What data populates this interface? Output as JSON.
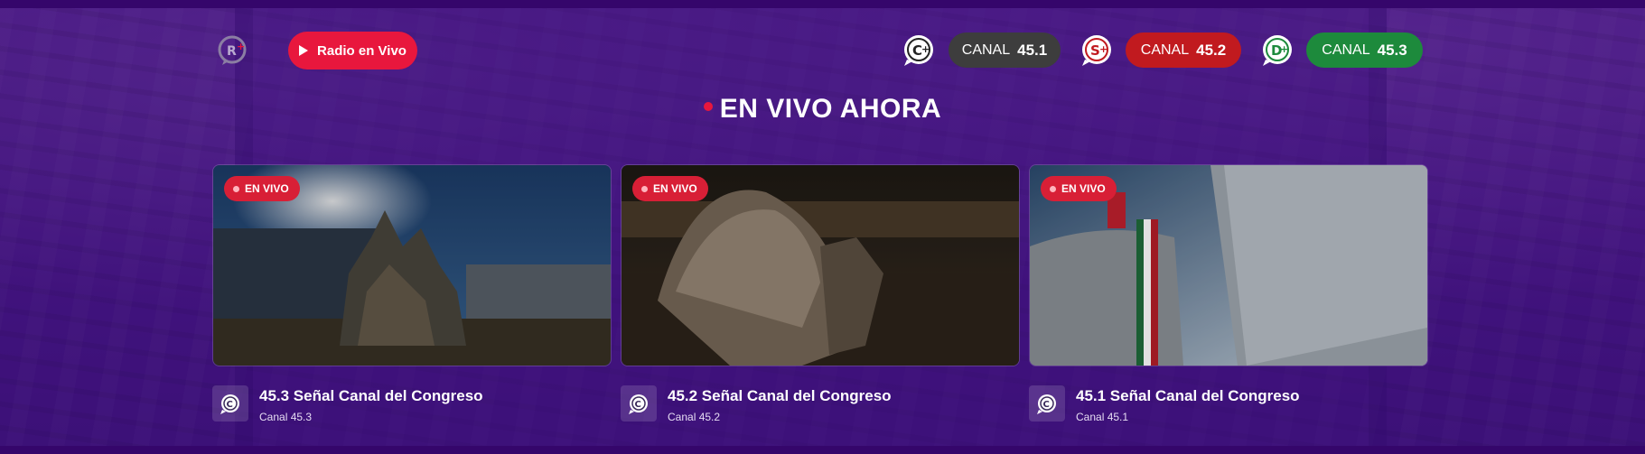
{
  "header": {
    "logo_icon": "radio-plus-logo-icon",
    "radio_button": {
      "label": "Radio en Vivo",
      "color": "#e8173d",
      "icon": "play-icon"
    },
    "channels": [
      {
        "prefix": "CANAL",
        "number": "45.1",
        "icon": "canal-c-plus-icon",
        "color": "#3d3d3d"
      },
      {
        "prefix": "CANAL",
        "number": "45.2",
        "icon": "canal-s-plus-icon",
        "color": "#c11a1f"
      },
      {
        "prefix": "CANAL",
        "number": "45.3",
        "icon": "canal-d-plus-icon",
        "color": "#1d8a3c"
      }
    ]
  },
  "section": {
    "title": "EN VIVO AHORA"
  },
  "cards": [
    {
      "badge": "EN VIVO",
      "title": "45.3 Señal Canal del Congreso",
      "subtitle": "Canal 45.3"
    },
    {
      "badge": "EN VIVO",
      "title": "45.2 Señal Canal del Congreso",
      "subtitle": "Canal 45.2"
    },
    {
      "badge": "EN VIVO",
      "title": "45.1 Señal Canal del Congreso",
      "subtitle": "Canal 45.1"
    }
  ],
  "colors": {
    "background": "#3a0c6e",
    "accent": "#e8173d",
    "live_badge": "#d81f36"
  }
}
